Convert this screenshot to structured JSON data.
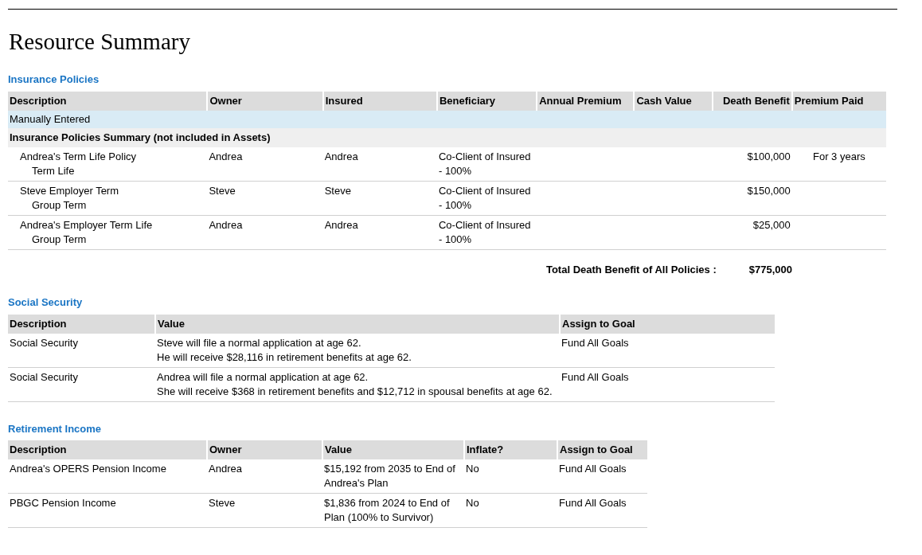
{
  "title": "Resource Summary",
  "insurance": {
    "heading": "Insurance Policies",
    "columns": [
      "Description",
      "Owner",
      "Insured",
      "Beneficiary",
      "Annual Premium",
      "Cash Value",
      "Death Benefit",
      "Premium Paid"
    ],
    "group_row": "Manually Entered",
    "summary_row": "Insurance Policies Summary (not included in Assets)",
    "rows": [
      {
        "description": "Andrea's Term Life Policy",
        "type": "Term Life",
        "owner": "Andrea",
        "insured": "Andrea",
        "beneficiary": [
          "Co-Client of Insured",
          "- 100%"
        ],
        "death_benefit": "$100,000",
        "premium_paid": "For 3 years"
      },
      {
        "description": "Steve Employer Term",
        "type": "Group Term",
        "owner": "Steve",
        "insured": "Steve",
        "beneficiary": [
          "Co-Client of Insured",
          "- 100%"
        ],
        "death_benefit": "$150,000"
      },
      {
        "description": "Andrea's Employer Term Life",
        "type": "Group Term",
        "owner": "Andrea",
        "insured": "Andrea",
        "beneficiary": [
          "Co-Client of Insured",
          "- 100%"
        ],
        "death_benefit": "$25,000"
      }
    ],
    "total": {
      "label": "Total Death Benefit of All Policies :",
      "value": "$775,000"
    }
  },
  "social_security": {
    "heading": "Social Security",
    "columns": [
      "Description",
      "Value",
      "Assign to Goal"
    ],
    "rows": [
      {
        "description": "Social Security",
        "value": [
          "Steve  will file a normal application at age 62.",
          "He will receive $28,116 in retirement benefits at age 62."
        ],
        "goal": "Fund All Goals"
      },
      {
        "description": "Social Security",
        "value": [
          "Andrea will file a normal application at age 62.",
          "She will receive $368 in retirement benefits and $12,712 in spousal benefits at age 62."
        ],
        "goal": "Fund All Goals"
      }
    ]
  },
  "retirement_income": {
    "heading": "Retirement Income",
    "columns": [
      "Description",
      "Owner",
      "Value",
      "Inflate?",
      "Assign to Goal"
    ],
    "rows": [
      {
        "description": "Andrea's OPERS Pension Income",
        "owner": "Andrea",
        "value": "$15,192 from 2035 to End of Andrea's Plan",
        "inflate": "No",
        "goal": "Fund All Goals"
      },
      {
        "description": "PBGC Pension Income",
        "owner": "Steve",
        "value": "$1,836 from 2024 to End of Plan (100% to Survivor)",
        "inflate": "No",
        "goal": "Fund All Goals"
      }
    ]
  }
}
